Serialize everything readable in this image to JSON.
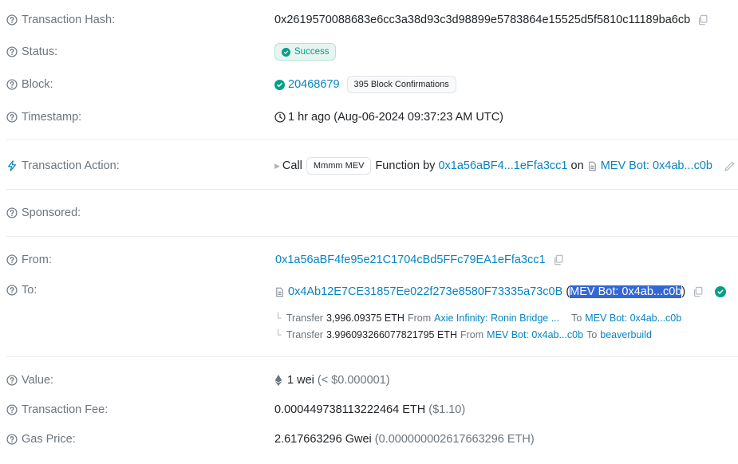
{
  "rows": {
    "tx_hash": {
      "label": "Transaction Hash:",
      "value": "0x2619570088683e6cc3a38d93c3d98899e5783864e15525d5f5810c11189ba6cb"
    },
    "status": {
      "label": "Status:",
      "value": "Success"
    },
    "block": {
      "label": "Block:",
      "number": "20468679",
      "confirmations": "395 Block Confirmations"
    },
    "timestamp": {
      "label": "Timestamp:",
      "value": "1 hr ago (Aug-06-2024 09:37:23 AM UTC)"
    },
    "tx_action": {
      "label": "Transaction Action:",
      "call": "Call",
      "function_name": "Mmmm MEV",
      "function_by": "Function by",
      "caller": "0x1a56aBF4...1eFfa3cc1",
      "on": "on",
      "contract": "MEV Bot: 0x4ab...c0b"
    },
    "sponsored": {
      "label": "Sponsored:"
    },
    "from": {
      "label": "From:",
      "address": "0x1a56aBF4fe95e21C1704cBd5FFc79EA1eFfa3cc1"
    },
    "to": {
      "label": "To:",
      "address": "0x4Ab12E7CE31857Ee022f273e8580F73335a73c0B",
      "name_open": "(",
      "name": "MEV Bot: 0x4ab...c0b",
      "name_close": ")",
      "transfers": [
        {
          "word": "Transfer",
          "amount": "3,996.09375 ETH",
          "from_word": "From",
          "from": "Axie Infinity: Ronin Bridge ...",
          "to_word": "To",
          "to": "MEV Bot: 0x4ab...c0b"
        },
        {
          "word": "Transfer",
          "amount": "3.996093266077821795 ETH",
          "from_word": "From",
          "from": "MEV Bot: 0x4ab...c0b",
          "to_word": "To",
          "to": "beaverbuild"
        }
      ]
    },
    "value": {
      "label": "Value:",
      "amount": "1 wei",
      "usd": "(< $0.000001)"
    },
    "fee": {
      "label": "Transaction Fee:",
      "amount": "0.000449738113222464 ETH",
      "usd": "($1.10)"
    },
    "gas_price": {
      "label": "Gas Price:",
      "amount": "2.617663296 Gwei",
      "eth": "(0.000000002617663296 ETH)"
    }
  },
  "colors": {
    "link": "#0784c3",
    "success": "#00a186",
    "label": "#6c757d",
    "selection": "#3367d6"
  }
}
